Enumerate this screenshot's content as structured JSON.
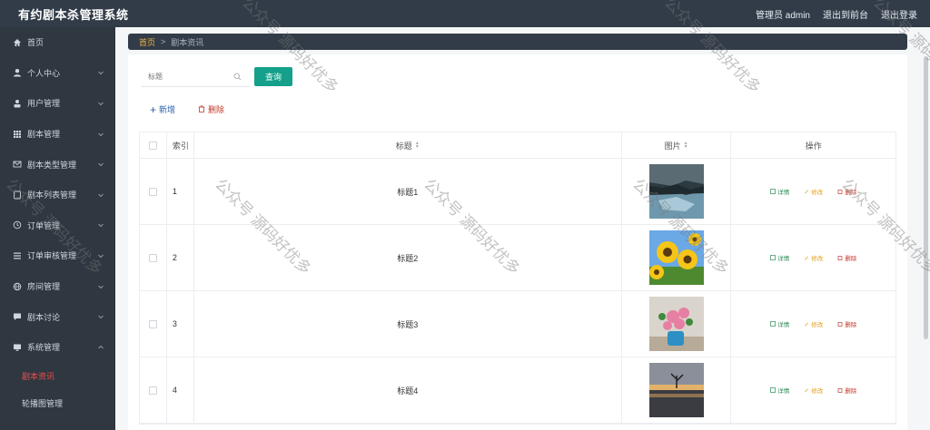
{
  "app": {
    "title": "有约剧本杀管理系统"
  },
  "header": {
    "user_label": "管理员 admin",
    "front_label": "退出到前台",
    "logout_label": "退出登录"
  },
  "sidebar": {
    "items": [
      {
        "label": "首页",
        "icon": "home-icon",
        "expandable": false
      },
      {
        "label": "个人中心",
        "icon": "user-icon",
        "expandable": true
      },
      {
        "label": "用户管理",
        "icon": "user-manage-icon",
        "expandable": true
      },
      {
        "label": "剧本管理",
        "icon": "grid-icon",
        "expandable": true
      },
      {
        "label": "剧本类型管理",
        "icon": "mail-icon",
        "expandable": true
      },
      {
        "label": "剧本列表管理",
        "icon": "list-icon",
        "expandable": true
      },
      {
        "label": "订单管理",
        "icon": "clock-icon",
        "expandable": true
      },
      {
        "label": "订单审核管理",
        "icon": "lines-icon",
        "expandable": true
      },
      {
        "label": "房间管理",
        "icon": "globe-icon",
        "expandable": true
      },
      {
        "label": "剧本讨论",
        "icon": "chat-icon",
        "expandable": true
      },
      {
        "label": "系统管理",
        "icon": "monitor-icon",
        "expandable": true,
        "expanded": true
      }
    ],
    "subitems": [
      {
        "label": "剧本资讯",
        "active": true
      },
      {
        "label": "轮播图管理",
        "active": false
      }
    ]
  },
  "breadcrumb": {
    "home": "首页",
    "separator": ">",
    "current": "剧本资讯"
  },
  "search": {
    "placeholder": "标题",
    "button_label": "查询"
  },
  "actions": {
    "add_label": "新增",
    "delete_label": "删除"
  },
  "table": {
    "headers": {
      "index": "索引",
      "title": "标题",
      "image": "图片",
      "ops": "操作"
    },
    "rows": [
      {
        "index": "1",
        "title": "标题1",
        "image": "river-photo"
      },
      {
        "index": "2",
        "title": "标题2",
        "image": "sunflower-photo"
      },
      {
        "index": "3",
        "title": "标题3",
        "image": "flowers-photo"
      },
      {
        "index": "4",
        "title": "标题4",
        "image": "sunset-tree-photo"
      }
    ],
    "op_labels": {
      "detail": "详情",
      "edit": "修改",
      "remove": "删除"
    }
  },
  "watermark": {
    "text": "公众号 源码好优多"
  },
  "colors": {
    "topbar": "#323c48",
    "sidebar": "#2f3740",
    "accent": "#14a08a",
    "active_menu": "#e94f4f",
    "danger": "#c0392b"
  }
}
